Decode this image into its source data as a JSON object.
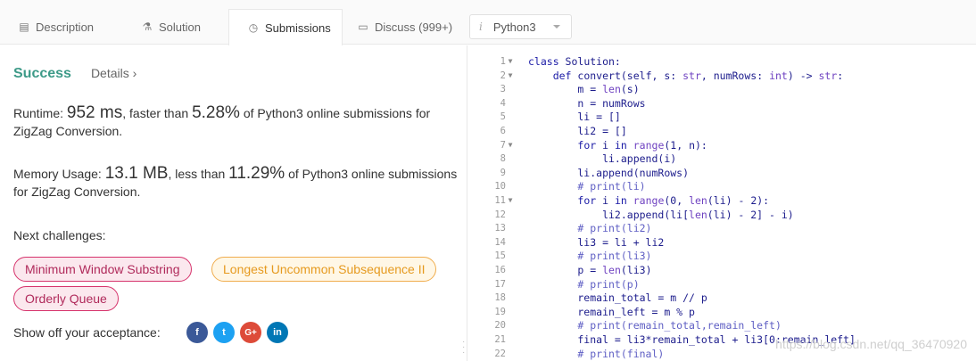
{
  "tabs": [
    {
      "label": "Description",
      "icon": "description-icon",
      "glyph": "▤"
    },
    {
      "label": "Solution",
      "icon": "flask-icon",
      "glyph": "⚗"
    },
    {
      "label": "Submissions",
      "icon": "clock-icon",
      "glyph": "◷"
    },
    {
      "label": "Discuss (999+)",
      "icon": "chat-icon",
      "glyph": "▭"
    }
  ],
  "language": {
    "icon_glyph": "i",
    "value": "Python3"
  },
  "result": {
    "status": "Success",
    "details": "Details ›"
  },
  "runtime": {
    "label": "Runtime: ",
    "value": "952 ms",
    "mid": ", faster than ",
    "percent": "5.28%",
    "tail": " of Python3 online submissions for ZigZag Conversion."
  },
  "memory": {
    "label": "Memory Usage: ",
    "value": "13.1 MB",
    "mid": ", less than ",
    "percent": "11.29%",
    "tail": " of Python3 online submissions for ZigZag Conversion."
  },
  "next": {
    "label": "Next challenges:",
    "items": [
      "Minimum Window Substring",
      "Longest Uncommon Subsequence II",
      "Orderly Queue"
    ]
  },
  "share": {
    "label": "Show off your acceptance:",
    "facebook": "f",
    "twitter": "t",
    "google": "G+",
    "linkedin": "in"
  },
  "colors": {
    "success": "#3d9a88",
    "hard": "#d6336c",
    "medium": "#f0ad4e",
    "facebook": "#3b5998",
    "twitter": "#1da1f2",
    "google": "#dd4b39",
    "linkedin": "#0077b5"
  },
  "code_lines": [
    {
      "n": "1",
      "fold": "▼",
      "indent": "",
      "html": "<span class=\"kw\">class</span> Solution:"
    },
    {
      "n": "2",
      "fold": "▼",
      "indent": "    ",
      "html": "<span class=\"kw\">def</span> convert(self, s: <span class=\"bi\">str</span>, numRows: <span class=\"bi\">int</span>) -> <span class=\"bi\">str</span>:"
    },
    {
      "n": "3",
      "fold": "",
      "indent": "        ",
      "html": "m = <span class=\"bi\">len</span>(s)"
    },
    {
      "n": "4",
      "fold": "",
      "indent": "        ",
      "html": "n = numRows"
    },
    {
      "n": "5",
      "fold": "",
      "indent": "        ",
      "html": "li = []"
    },
    {
      "n": "6",
      "fold": "",
      "indent": "        ",
      "html": "li2 = []"
    },
    {
      "n": "7",
      "fold": "▼",
      "indent": "        ",
      "html": "<span class=\"kw\">for</span> i <span class=\"kw\">in</span> <span class=\"bi\">range</span>(1, n):"
    },
    {
      "n": "8",
      "fold": "",
      "indent": "            ",
      "html": "li.append(i)"
    },
    {
      "n": "9",
      "fold": "",
      "indent": "        ",
      "html": "li.append(numRows)"
    },
    {
      "n": "10",
      "fold": "",
      "indent": "        ",
      "html": "<span class=\"cm\"># print(li)</span>"
    },
    {
      "n": "11",
      "fold": "▼",
      "indent": "        ",
      "html": "<span class=\"kw\">for</span> i <span class=\"kw\">in</span> <span class=\"bi\">range</span>(0, <span class=\"bi\">len</span>(li) - 2):"
    },
    {
      "n": "12",
      "fold": "",
      "indent": "            ",
      "html": "li2.append(li[<span class=\"bi\">len</span>(li) - 2] - i)"
    },
    {
      "n": "13",
      "fold": "",
      "indent": "        ",
      "html": "<span class=\"cm\"># print(li2)</span>"
    },
    {
      "n": "14",
      "fold": "",
      "indent": "        ",
      "html": "li3 = li + li2"
    },
    {
      "n": "15",
      "fold": "",
      "indent": "        ",
      "html": "<span class=\"cm\"># print(li3)</span>"
    },
    {
      "n": "16",
      "fold": "",
      "indent": "        ",
      "html": "p = <span class=\"bi\">len</span>(li3)"
    },
    {
      "n": "17",
      "fold": "",
      "indent": "        ",
      "html": "<span class=\"cm\"># print(p)</span>"
    },
    {
      "n": "18",
      "fold": "",
      "indent": "        ",
      "html": "remain_total = m // p"
    },
    {
      "n": "19",
      "fold": "",
      "indent": "        ",
      "html": "remain_left = m % p"
    },
    {
      "n": "20",
      "fold": "",
      "indent": "        ",
      "html": "<span class=\"cm\"># print(remain_total,remain_left)</span>"
    },
    {
      "n": "21",
      "fold": "",
      "indent": "        ",
      "html": "final = li3*remain_total + li3[0:remain_left]"
    },
    {
      "n": "22",
      "fold": "",
      "indent": "        ",
      "html": "<span class=\"cm\"># print(final)</span>"
    }
  ],
  "watermark": "https://blog.csdn.net/qq_36470920"
}
